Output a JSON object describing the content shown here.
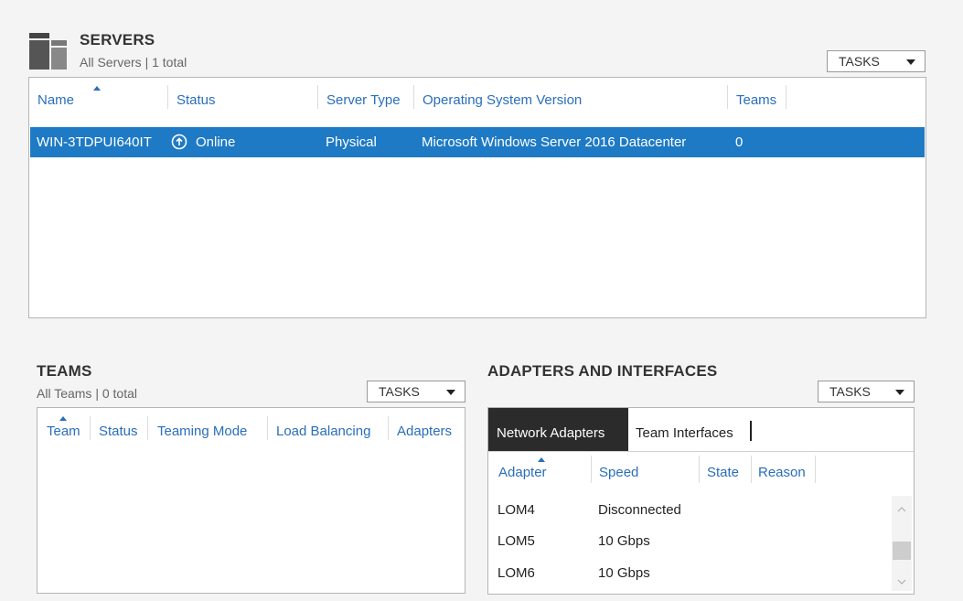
{
  "servers": {
    "title": "SERVERS",
    "subtitle": "All Servers | 1 total",
    "tasks_label": "TASKS",
    "columns": [
      "Name",
      "Status",
      "Server Type",
      "Operating System Version",
      "Teams"
    ],
    "rows": [
      {
        "name": "WIN-3TDPUI640IT",
        "status": "Online",
        "server_type": "Physical",
        "os": "Microsoft Windows Server 2016 Datacenter",
        "teams": "0"
      }
    ]
  },
  "teams": {
    "title": "TEAMS",
    "subtitle": "All Teams | 0 total",
    "tasks_label": "TASKS",
    "columns": [
      "Team",
      "Status",
      "Teaming Mode",
      "Load Balancing",
      "Adapters"
    ]
  },
  "adapters": {
    "title": "ADAPTERS AND INTERFACES",
    "tasks_label": "TASKS",
    "tabs": [
      "Network Adapters",
      "Team Interfaces"
    ],
    "columns": [
      "Adapter",
      "Speed",
      "State",
      "Reason"
    ],
    "rows": [
      {
        "adapter": "LOM4",
        "speed": "Disconnected"
      },
      {
        "adapter": "LOM5",
        "speed": "10 Gbps"
      },
      {
        "adapter": "LOM6",
        "speed": "10 Gbps"
      }
    ]
  },
  "colors": {
    "selection": "#1e7ac4",
    "header_link": "#2a6ebb",
    "active_tab": "#2b2b2b"
  },
  "icons": [
    "server-group-icon",
    "online-status-icon",
    "chevron-up-icon",
    "chevron-down-icon"
  ]
}
